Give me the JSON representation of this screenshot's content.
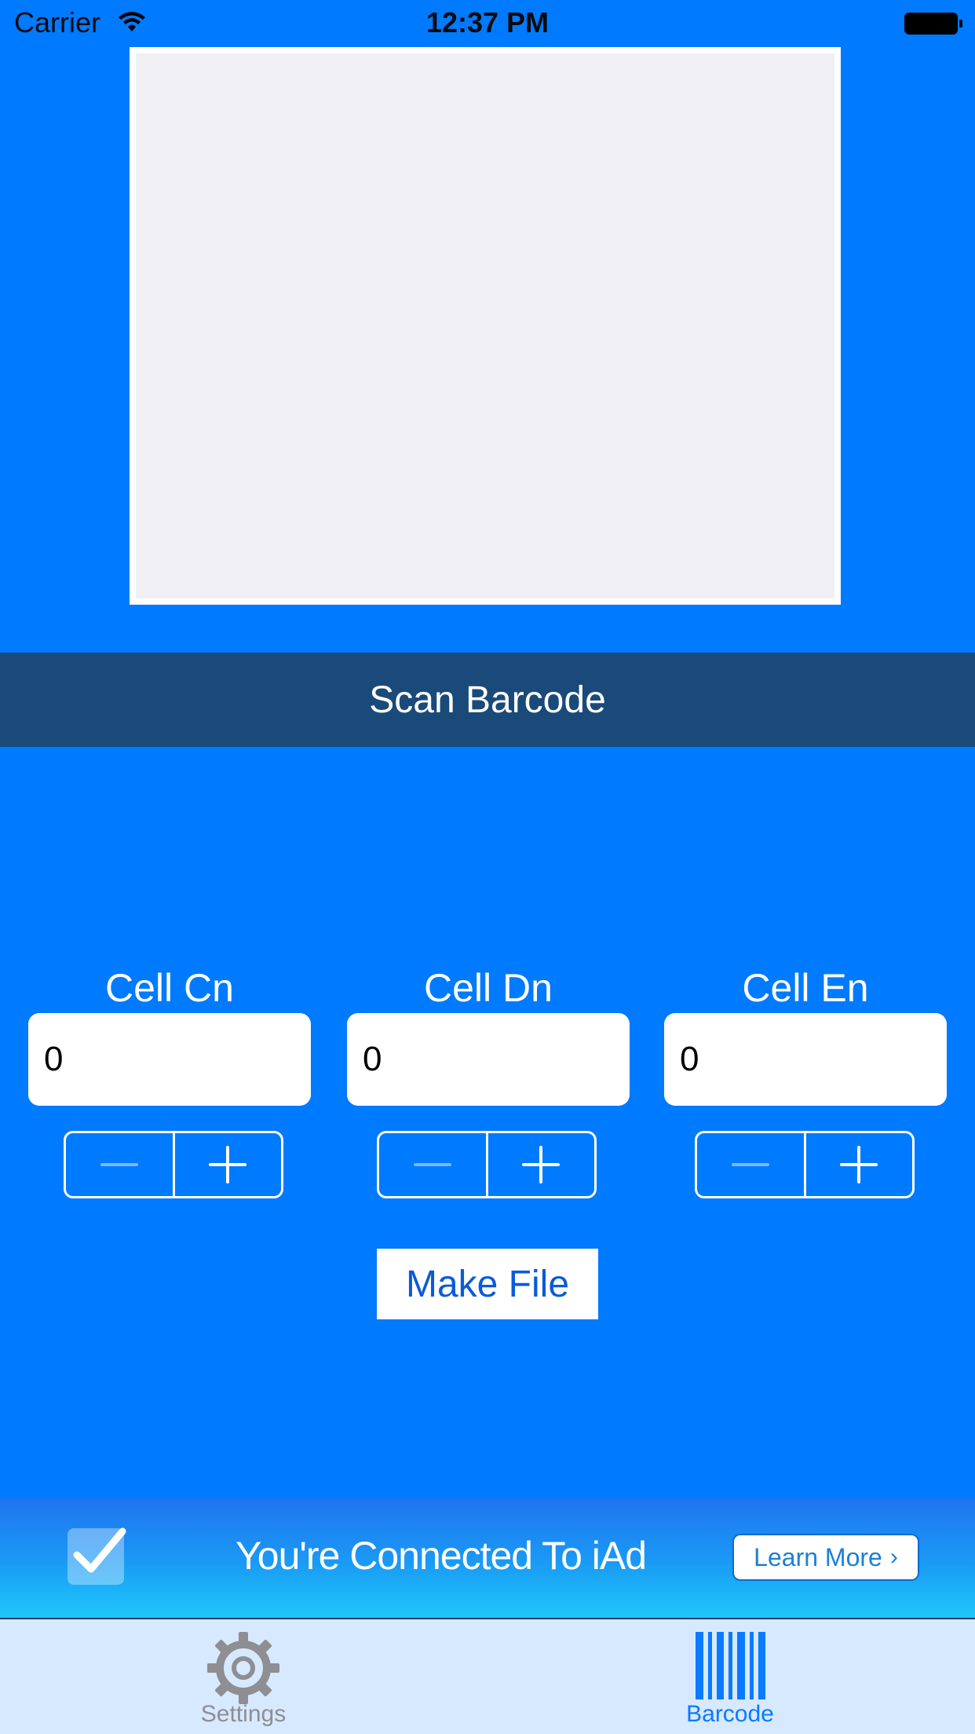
{
  "status_bar": {
    "carrier": "Carrier",
    "time": "12:37 PM"
  },
  "scan": {
    "label": "Scan Barcode"
  },
  "cells": [
    {
      "label": "Cell Cn",
      "value": "0"
    },
    {
      "label": "Cell Dn",
      "value": "0"
    },
    {
      "label": "Cell En",
      "value": "0"
    }
  ],
  "make_file": {
    "label": "Make File"
  },
  "iad": {
    "text": "You're Connected To iAd",
    "learn_more": "Learn More",
    "chevron": "›"
  },
  "tabs": [
    {
      "label": "Settings",
      "icon": "gear-icon",
      "selected": false
    },
    {
      "label": "Barcode",
      "icon": "barcode-icon",
      "selected": true
    }
  ],
  "colors": {
    "background": "#007aff",
    "scan_bar": "#1a4a7a",
    "tab_bar": "#d7e9ff",
    "tab_selected": "#0a7aff",
    "tab_unselected": "#8e8e93"
  }
}
